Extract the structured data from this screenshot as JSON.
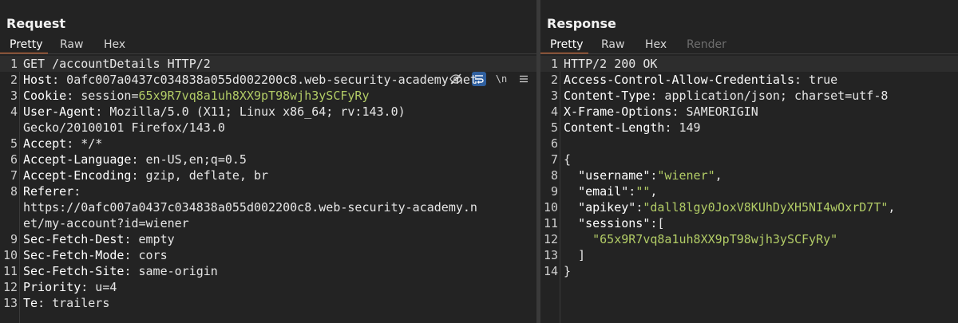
{
  "request": {
    "title": "Request",
    "tabs": [
      {
        "label": "Pretty",
        "active": true
      },
      {
        "label": "Raw"
      },
      {
        "label": "Hex"
      }
    ],
    "toolbar": {
      "newline_label": "\\n"
    },
    "lines": [
      {
        "n": "1",
        "a": "GET /accountDetails HTTP/2"
      },
      {
        "n": "2",
        "k": "Host",
        "v": " 0afc007a0437c034838a055d002200c8.web-security-academy.net"
      },
      {
        "n": "3",
        "k": "Cookie",
        "v": " session=",
        "g": "65x9R7vq8a1uh8XX9pT98wjh3ySCFyRy"
      },
      {
        "n": "4",
        "k": "User-Agent",
        "v": " Mozilla/5.0 (X11; Linux x86_64; rv:143.0)"
      },
      {
        "n": "",
        "a": "Gecko/20100101 Firefox/143.0"
      },
      {
        "n": "5",
        "k": "Accept",
        "v": " */*"
      },
      {
        "n": "6",
        "k": "Accept-Language",
        "v": " en-US,en;q=0.5"
      },
      {
        "n": "7",
        "k": "Accept-Encoding",
        "v": " gzip, deflate, br"
      },
      {
        "n": "8",
        "k": "Referer",
        "v": ""
      },
      {
        "n": "",
        "a": "https://0afc007a0437c034838a055d002200c8.web-security-academy.n"
      },
      {
        "n": "",
        "a": "et/my-account?id=wiener"
      },
      {
        "n": "9",
        "k": "Sec-Fetch-Dest",
        "v": " empty"
      },
      {
        "n": "10",
        "k": "Sec-Fetch-Mode",
        "v": " cors"
      },
      {
        "n": "11",
        "k": "Sec-Fetch-Site",
        "v": " same-origin"
      },
      {
        "n": "12",
        "k": "Priority",
        "v": " u=4"
      },
      {
        "n": "13",
        "k": "Te",
        "v": " trailers"
      }
    ]
  },
  "response": {
    "title": "Response",
    "tabs": [
      {
        "label": "Pretty",
        "active": true
      },
      {
        "label": "Raw"
      },
      {
        "label": "Hex"
      },
      {
        "label": "Render",
        "disabled": true
      }
    ],
    "lines": [
      {
        "n": "1",
        "a": "HTTP/2 200 OK"
      },
      {
        "n": "2",
        "k": "Access-Control-Allow-Credentials",
        "v": " true"
      },
      {
        "n": "3",
        "k": "Content-Type",
        "v": " application/json; charset=utf-8"
      },
      {
        "n": "4",
        "k": "X-Frame-Options",
        "v": " SAMEORIGIN"
      },
      {
        "n": "5",
        "k": "Content-Length",
        "v": " 149"
      },
      {
        "n": "6",
        "a": ""
      },
      {
        "n": "7",
        "a": "{"
      },
      {
        "n": "8",
        "ind": "  ",
        "jk": "\"username\"",
        "sep": ":",
        "jv": "\"wiener\"",
        "end": ","
      },
      {
        "n": "9",
        "ind": "  ",
        "jk": "\"email\"",
        "sep": ":",
        "jv": "\"\"",
        "end": ","
      },
      {
        "n": "10",
        "ind": "  ",
        "jk": "\"apikey\"",
        "sep": ":",
        "jv": "\"dall8lgy0JoxV8KUhDyXH5NI4wOxrD7T\"",
        "end": ","
      },
      {
        "n": "11",
        "ind": "  ",
        "jk": "\"sessions\"",
        "sep": ":[",
        "jv": "",
        "end": ""
      },
      {
        "n": "12",
        "ind": "    ",
        "jv": "\"65x9R7vq8a1uh8XX9pT98wjh3ySCFyRy\""
      },
      {
        "n": "13",
        "a": "  ]"
      },
      {
        "n": "14",
        "a": "}"
      }
    ]
  },
  "colors": {
    "accent": "#e8753a",
    "string": "#b2cc66",
    "toggle_active": "#2f5f9e"
  },
  "icons": [
    "eye-off-icon",
    "wrap-lines-icon",
    "newline-icon",
    "menu-icon"
  ]
}
